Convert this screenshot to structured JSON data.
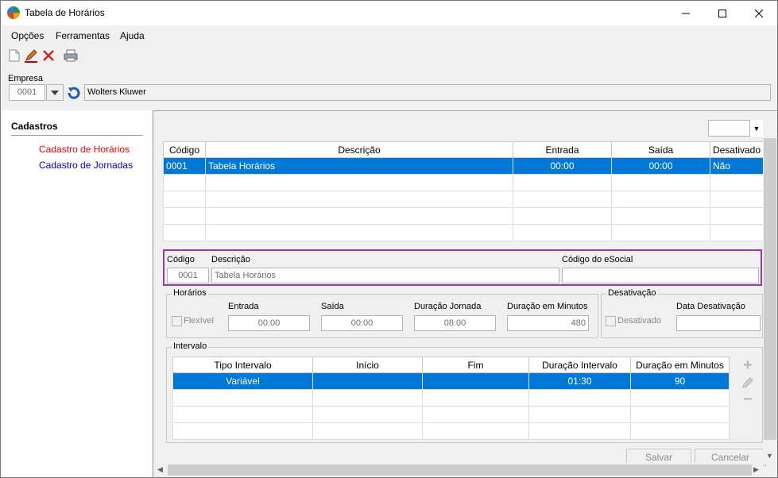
{
  "window": {
    "title": "Tabela de Horários"
  },
  "menu": [
    {
      "label": "Opções"
    },
    {
      "label": "Ferramentas"
    },
    {
      "label": "Ajuda"
    }
  ],
  "toolbar": {
    "icons": [
      "new-document-icon",
      "edit-pencil-icon",
      "delete-x-icon",
      "print-icon"
    ]
  },
  "empresa": {
    "label": "Empresa",
    "code": "0001",
    "name": "Wolters Kluwer"
  },
  "sidebar": {
    "title": "Cadastros",
    "items": [
      {
        "label": "Cadastro de Horários",
        "color": "#ff0000"
      },
      {
        "label": "Cadastro de Jornadas",
        "color": "#0000cc"
      }
    ]
  },
  "grid": {
    "headers": [
      "Código",
      "Descrição",
      "Entrada",
      "Saída",
      "Desativado"
    ],
    "rows": [
      [
        "0001",
        "Tabela Horários",
        "00:00",
        "00:00",
        "Não"
      ]
    ]
  },
  "detail": {
    "codigo_label": "Código",
    "codigo": "0001",
    "descricao_label": "Descrição",
    "descricao": "Tabela Horários",
    "esocial_label": "Código do eSocial",
    "esocial": ""
  },
  "horarios": {
    "legend": "Horários",
    "flexivel_label": "Flexível",
    "entrada_label": "Entrada",
    "entrada": "00:00",
    "saida_label": "Saída",
    "saida": "00:00",
    "duracao_label": "Duração Jornada",
    "duracao": "08:00",
    "minutos_label": "Duração em Minutos",
    "minutos": "480"
  },
  "desativacao": {
    "legend": "Desativação",
    "desativado_label": "Desativado",
    "data_label": "Data Desativação",
    "data": ""
  },
  "intervalo": {
    "legend": "Intervalo",
    "headers": [
      "Tipo Intervalo",
      "Início",
      "Fim",
      "Duração Intervalo",
      "Duração em Minutos"
    ],
    "rows": [
      [
        "Variável",
        "",
        "",
        "01:30",
        "90"
      ]
    ]
  },
  "buttons": {
    "save": "Salvar",
    "cancel": "Cancelar"
  },
  "colors": {
    "selection": "#0078d7",
    "highlight_border": "#9b3aa0"
  }
}
